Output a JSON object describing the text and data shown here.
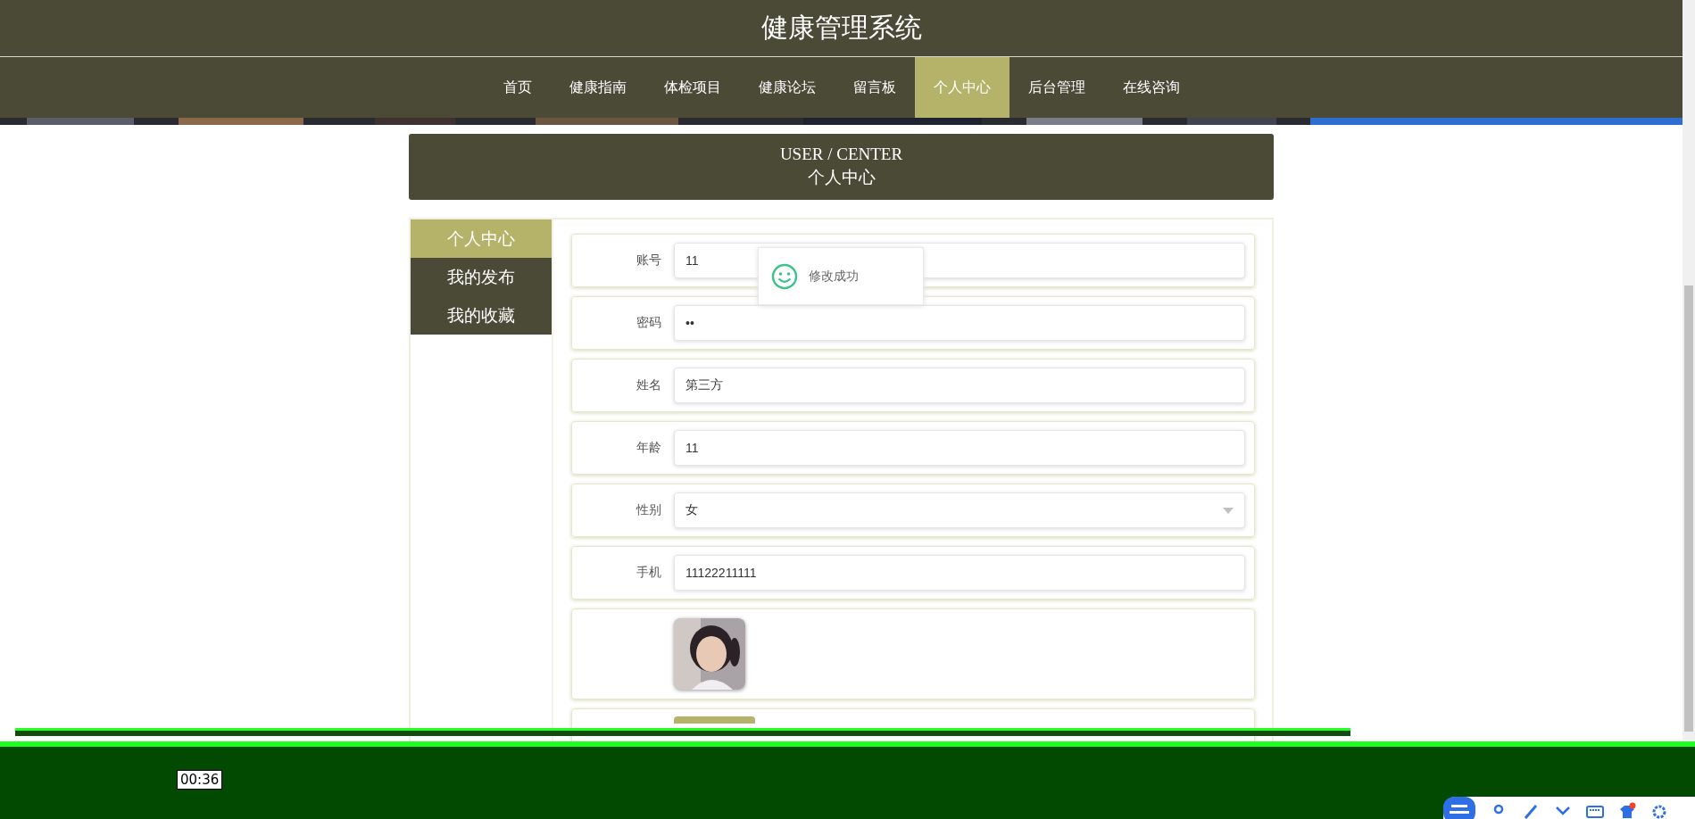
{
  "header": {
    "title": "健康管理系统"
  },
  "nav": [
    {
      "label": "首页",
      "selected": false
    },
    {
      "label": "健康指南",
      "selected": false
    },
    {
      "label": "体检项目",
      "selected": false
    },
    {
      "label": "健康论坛",
      "selected": false
    },
    {
      "label": "留言板",
      "selected": false
    },
    {
      "label": "个人中心",
      "selected": true
    },
    {
      "label": "后台管理",
      "selected": false
    },
    {
      "label": "在线咨询",
      "selected": false
    }
  ],
  "panel": {
    "title_en": "USER / CENTER",
    "title": "个人中心"
  },
  "sidebar": [
    {
      "label": "个人中心",
      "selected": true
    },
    {
      "label": "我的发布",
      "selected": false
    },
    {
      "label": "我的收藏",
      "selected": false
    }
  ],
  "form": {
    "fields": [
      {
        "kind": "text",
        "label": "账号",
        "value": "11"
      },
      {
        "kind": "text",
        "label": "密码",
        "value": "••"
      },
      {
        "kind": "text",
        "label": "姓名",
        "value": "第三方"
      },
      {
        "kind": "text",
        "label": "年龄",
        "value": "11"
      },
      {
        "kind": "select",
        "label": "性别",
        "value": "女"
      },
      {
        "kind": "text",
        "label": "手机",
        "value": "11122211111"
      }
    ]
  },
  "toast": {
    "message": "修改成功"
  },
  "video": {
    "time": "00:36"
  }
}
